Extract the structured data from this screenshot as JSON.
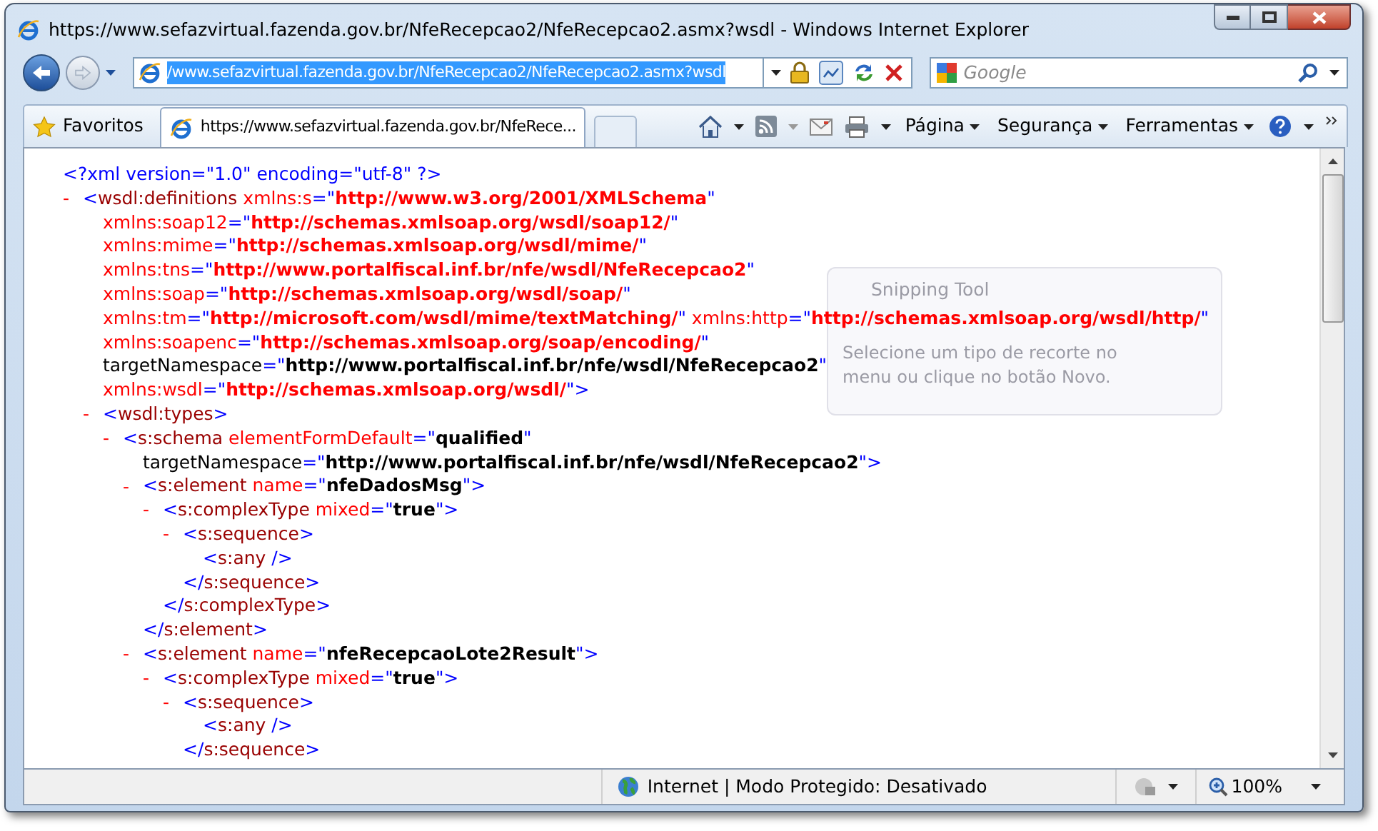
{
  "window": {
    "title": "https://www.sefazvirtual.fazenda.gov.br/NfeRecepcao2/NfeRecepcao2.asmx?wsdl - Windows Internet Explorer"
  },
  "address_bar": {
    "value": "/www.sefazvirtual.fazenda.gov.br/NfeRecepcao2/NfeRecepcao2.asmx?wsdl",
    "selected": true
  },
  "search": {
    "placeholder": "Google"
  },
  "favorites": {
    "label": "Favoritos"
  },
  "tabs": [
    {
      "label": "https://www.sefazvirtual.fazenda.gov.br/NfeRece...",
      "selected": true
    }
  ],
  "command_bar": [
    "Página",
    "Segurança",
    "Ferramentas"
  ],
  "document": {
    "prolog": [
      {
        "kind": "mark",
        "text": "<?xml version=\"1.0\" encoding=\"utf-8\" ?>"
      }
    ],
    "nodes": [
      {
        "toggle": "-",
        "open": [
          [
            {
              "kind": "mark",
              "text": "<"
            },
            {
              "kind": "tag",
              "text": "wsdl:definitions"
            },
            {
              "kind": "attr",
              "text": " xmlns:s"
            },
            {
              "kind": "mark",
              "text": "=\""
            },
            {
              "kind": "nsvalue",
              "text": "http://www.w3.org/2001/XMLSchema"
            },
            {
              "kind": "mark",
              "text": "\""
            }
          ],
          [
            {
              "kind": "attr",
              "text": "xmlns:soap12"
            },
            {
              "kind": "mark",
              "text": "=\""
            },
            {
              "kind": "nsvalue",
              "text": "http://schemas.xmlsoap.org/wsdl/soap12/"
            },
            {
              "kind": "mark",
              "text": "\""
            }
          ],
          [
            {
              "kind": "attr",
              "text": "xmlns:mime"
            },
            {
              "kind": "mark",
              "text": "=\""
            },
            {
              "kind": "nsvalue",
              "text": "http://schemas.xmlsoap.org/wsdl/mime/"
            },
            {
              "kind": "mark",
              "text": "\""
            }
          ],
          [
            {
              "kind": "attr",
              "text": "xmlns:tns"
            },
            {
              "kind": "mark",
              "text": "=\""
            },
            {
              "kind": "nsvalue",
              "text": "http://www.portalfiscal.inf.br/nfe/wsdl/NfeRecepcao2"
            },
            {
              "kind": "mark",
              "text": "\""
            }
          ],
          [
            {
              "kind": "attr",
              "text": "xmlns:soap"
            },
            {
              "kind": "mark",
              "text": "=\""
            },
            {
              "kind": "nsvalue",
              "text": "http://schemas.xmlsoap.org/wsdl/soap/"
            },
            {
              "kind": "mark",
              "text": "\""
            }
          ],
          [
            {
              "kind": "attr",
              "text": "xmlns:tm"
            },
            {
              "kind": "mark",
              "text": "=\""
            },
            {
              "kind": "nsvalue",
              "text": "http://microsoft.com/wsdl/mime/textMatching/"
            },
            {
              "kind": "mark",
              "text": "\""
            },
            {
              "kind": "attr",
              "text": " xmlns:http"
            },
            {
              "kind": "mark",
              "text": "=\""
            },
            {
              "kind": "nsvalue",
              "text": "http://schemas.xmlsoap.org/wsdl/http/"
            },
            {
              "kind": "mark",
              "text": "\""
            }
          ],
          [
            {
              "kind": "attr",
              "text": "xmlns:soapenc"
            },
            {
              "kind": "mark",
              "text": "=\""
            },
            {
              "kind": "nsvalue",
              "text": "http://schemas.xmlsoap.org/soap/encoding/"
            },
            {
              "kind": "mark",
              "text": "\""
            }
          ],
          [
            {
              "kind": "text",
              "text": "targetNamespace"
            },
            {
              "kind": "mark",
              "text": "=\""
            },
            {
              "kind": "value",
              "text": "http://www.portalfiscal.inf.br/nfe/wsdl/NfeRecepcao2"
            },
            {
              "kind": "mark",
              "text": "\""
            }
          ],
          [
            {
              "kind": "attr",
              "text": "xmlns:wsdl"
            },
            {
              "kind": "mark",
              "text": "=\""
            },
            {
              "kind": "nsvalue",
              "text": "http://schemas.xmlsoap.org/wsdl/"
            },
            {
              "kind": "mark",
              "text": "\">"
            }
          ]
        ],
        "children": [
          {
            "toggle": "-",
            "open": [
              [
                {
                  "kind": "mark",
                  "text": "<"
                },
                {
                  "kind": "tag",
                  "text": "wsdl:types"
                },
                {
                  "kind": "mark",
                  "text": ">"
                }
              ]
            ],
            "children": [
              {
                "toggle": "-",
                "open": [
                  [
                    {
                      "kind": "mark",
                      "text": "<"
                    },
                    {
                      "kind": "tag",
                      "text": "s:schema"
                    },
                    {
                      "kind": "attr",
                      "text": " elementFormDefault"
                    },
                    {
                      "kind": "mark",
                      "text": "=\""
                    },
                    {
                      "kind": "value",
                      "text": "qualified"
                    },
                    {
                      "kind": "mark",
                      "text": "\""
                    }
                  ],
                  [
                    {
                      "kind": "text",
                      "text": "targetNamespace"
                    },
                    {
                      "kind": "mark",
                      "text": "=\""
                    },
                    {
                      "kind": "value",
                      "text": "http://www.portalfiscal.inf.br/nfe/wsdl/NfeRecepcao2"
                    },
                    {
                      "kind": "mark",
                      "text": "\">"
                    }
                  ]
                ],
                "children": [
                  {
                    "toggle": "-",
                    "open": [
                      [
                        {
                          "kind": "mark",
                          "text": "<"
                        },
                        {
                          "kind": "tag",
                          "text": "s:element"
                        },
                        {
                          "kind": "attr",
                          "text": " name"
                        },
                        {
                          "kind": "mark",
                          "text": "=\""
                        },
                        {
                          "kind": "value",
                          "text": "nfeDadosMsg"
                        },
                        {
                          "kind": "mark",
                          "text": "\">"
                        }
                      ]
                    ],
                    "children": [
                      {
                        "toggle": "-",
                        "open": [
                          [
                            {
                              "kind": "mark",
                              "text": "<"
                            },
                            {
                              "kind": "tag",
                              "text": "s:complexType"
                            },
                            {
                              "kind": "attr",
                              "text": " mixed"
                            },
                            {
                              "kind": "mark",
                              "text": "=\""
                            },
                            {
                              "kind": "value",
                              "text": "true"
                            },
                            {
                              "kind": "mark",
                              "text": "\">"
                            }
                          ]
                        ],
                        "children": [
                          {
                            "toggle": "-",
                            "open": [
                              [
                                {
                                  "kind": "mark",
                                  "text": "<"
                                },
                                {
                                  "kind": "tag",
                                  "text": "s:sequence"
                                },
                                {
                                  "kind": "mark",
                                  "text": ">"
                                }
                              ]
                            ],
                            "children": [
                              {
                                "open": [
                                  [
                                    {
                                      "kind": "mark",
                                      "text": "<"
                                    },
                                    {
                                      "kind": "tag",
                                      "text": "s:any"
                                    },
                                    {
                                      "kind": "mark",
                                      "text": " />"
                                    }
                                  ]
                                ]
                              }
                            ],
                            "close": [
                              {
                                "kind": "mark",
                                "text": "</"
                              },
                              {
                                "kind": "tag",
                                "text": "s:sequence"
                              },
                              {
                                "kind": "mark",
                                "text": ">"
                              }
                            ]
                          }
                        ],
                        "close": [
                          {
                            "kind": "mark",
                            "text": "</"
                          },
                          {
                            "kind": "tag",
                            "text": "s:complexType"
                          },
                          {
                            "kind": "mark",
                            "text": ">"
                          }
                        ]
                      }
                    ],
                    "close": [
                      {
                        "kind": "mark",
                        "text": "</"
                      },
                      {
                        "kind": "tag",
                        "text": "s:element"
                      },
                      {
                        "kind": "mark",
                        "text": ">"
                      }
                    ]
                  },
                  {
                    "toggle": "-",
                    "open": [
                      [
                        {
                          "kind": "mark",
                          "text": "<"
                        },
                        {
                          "kind": "tag",
                          "text": "s:element"
                        },
                        {
                          "kind": "attr",
                          "text": " name"
                        },
                        {
                          "kind": "mark",
                          "text": "=\""
                        },
                        {
                          "kind": "value",
                          "text": "nfeRecepcaoLote2Result"
                        },
                        {
                          "kind": "mark",
                          "text": "\">"
                        }
                      ]
                    ],
                    "children": [
                      {
                        "toggle": "-",
                        "open": [
                          [
                            {
                              "kind": "mark",
                              "text": "<"
                            },
                            {
                              "kind": "tag",
                              "text": "s:complexType"
                            },
                            {
                              "kind": "attr",
                              "text": " mixed"
                            },
                            {
                              "kind": "mark",
                              "text": "=\""
                            },
                            {
                              "kind": "value",
                              "text": "true"
                            },
                            {
                              "kind": "mark",
                              "text": "\">"
                            }
                          ]
                        ],
                        "children": [
                          {
                            "toggle": "-",
                            "open": [
                              [
                                {
                                  "kind": "mark",
                                  "text": "<"
                                },
                                {
                                  "kind": "tag",
                                  "text": "s:sequence"
                                },
                                {
                                  "kind": "mark",
                                  "text": ">"
                                }
                              ]
                            ],
                            "children": [
                              {
                                "open": [
                                  [
                                    {
                                      "kind": "mark",
                                      "text": "<"
                                    },
                                    {
                                      "kind": "tag",
                                      "text": "s:any"
                                    },
                                    {
                                      "kind": "mark",
                                      "text": " />"
                                    }
                                  ]
                                ]
                              }
                            ],
                            "close": [
                              {
                                "kind": "mark",
                                "text": "</"
                              },
                              {
                                "kind": "tag",
                                "text": "s:sequence"
                              },
                              {
                                "kind": "mark",
                                "text": ">"
                              }
                            ]
                          }
                        ]
                      }
                    ]
                  }
                ]
              }
            ]
          }
        ]
      }
    ]
  },
  "overlay": {
    "title": "Snipping Tool",
    "message": "Selecione um tipo de recorte no menu ou clique no botão Novo."
  },
  "status_bar": {
    "zone": "Internet | Modo Protegido: Desativado",
    "zoom": "100%"
  }
}
